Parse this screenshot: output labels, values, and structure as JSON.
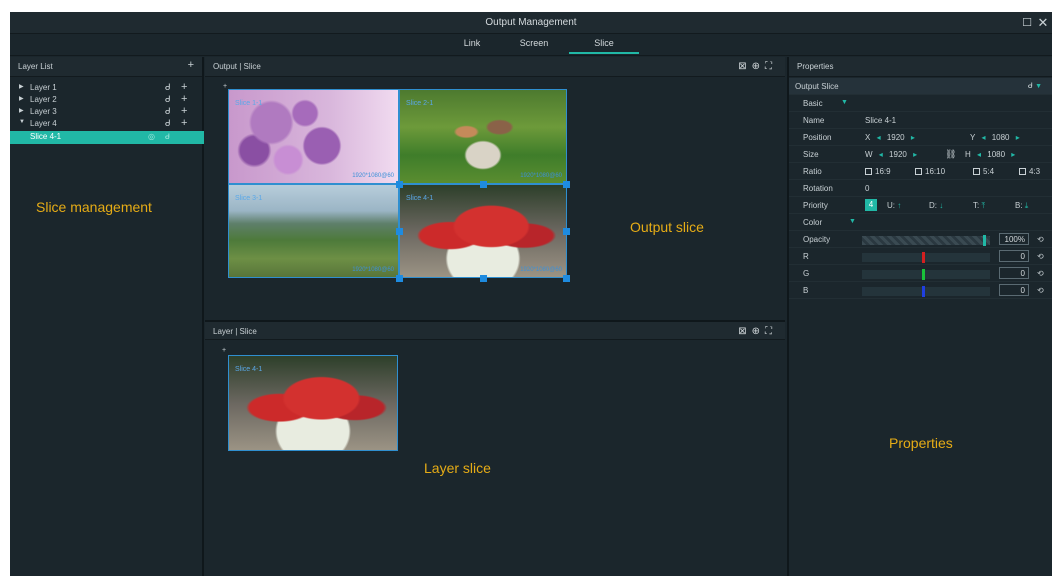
{
  "window": {
    "title": "Output Management",
    "maximize_icon": "maximize-icon",
    "close_icon": "close-icon"
  },
  "tabs": [
    {
      "label": "Link",
      "active": false
    },
    {
      "label": "Screen",
      "active": false
    },
    {
      "label": "Slice",
      "active": true
    }
  ],
  "layer_list": {
    "title": "Layer List",
    "add_label": "+",
    "layers": [
      {
        "name": "Layer 1",
        "expanded": false
      },
      {
        "name": "Layer 2",
        "expanded": false
      },
      {
        "name": "Layer 3",
        "expanded": false
      },
      {
        "name": "Layer 4",
        "expanded": true
      }
    ],
    "slices": [
      {
        "name": "Slice 4-1",
        "selected": true
      }
    ]
  },
  "output_panel": {
    "title": "Output | Slice",
    "slices": [
      {
        "label": "Slice 1-1",
        "res": "1920*1080@60",
        "image": "lilac-flowers"
      },
      {
        "label": "Slice 2-1",
        "res": "1920*1080@60",
        "image": "family-picnic"
      },
      {
        "label": "Slice 3-1",
        "res": "1920*1080@60",
        "image": "valley-landscape"
      },
      {
        "label": "Slice 4-1",
        "res": "1920*1080@60",
        "image": "watermelon"
      }
    ]
  },
  "layer_panel": {
    "title": "Layer | Slice",
    "slice_label": "Slice 4-1"
  },
  "properties": {
    "title": "Properties",
    "section": "Output Slice",
    "basic_label": "Basic",
    "name_label": "Name",
    "name_value": "Slice 4-1",
    "position_label": "Position",
    "x_label": "X",
    "x_value": "1920",
    "y_label": "Y",
    "y_value": "1080",
    "size_label": "Size",
    "w_label": "W",
    "w_value": "1920",
    "h_label": "H",
    "h_value": "1080",
    "ratio_label": "Ratio",
    "ratio_options": [
      "16:9",
      "16:10",
      "5:4",
      "4:3"
    ],
    "rotation_label": "Rotation",
    "rotation_value": "0",
    "priority_label": "Priority",
    "priority_value": "4",
    "priority_buttons": [
      "U:",
      "D:",
      "T:",
      "B:"
    ],
    "color_label": "Color",
    "opacity_label": "Opacity",
    "opacity_value": "100%",
    "r_label": "R",
    "r_value": "0",
    "g_label": "G",
    "g_value": "0",
    "b_label": "B",
    "b_value": "0"
  },
  "annotations": {
    "slice_management": "Slice management",
    "output_slice": "Output slice",
    "layer_slice": "Layer slice",
    "properties": "Properties"
  },
  "colors": {
    "accent": "#21b8a6",
    "annotation": "#e6ac16",
    "slice_border": "#2f8fd0",
    "r_mark": "#d42020",
    "g_mark": "#19c23a",
    "b_mark": "#1f3fe0"
  }
}
